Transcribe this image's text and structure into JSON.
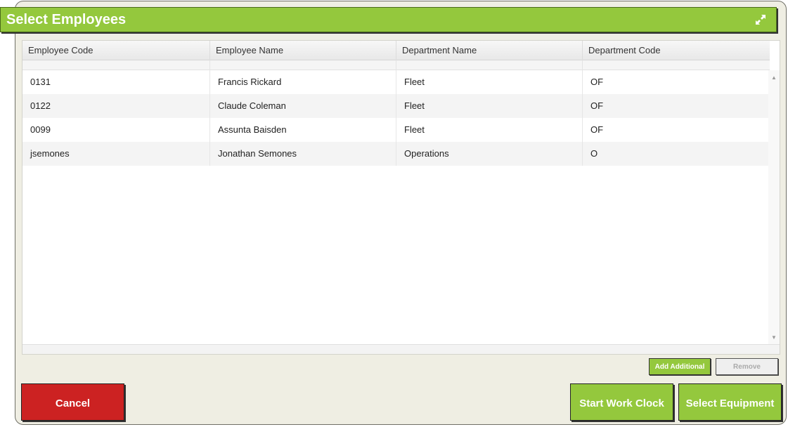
{
  "dialog": {
    "title": "Select Employees"
  },
  "table": {
    "columns": [
      "Employee Code",
      "Employee Name",
      "Department Name",
      "Department Code"
    ],
    "rows": [
      [
        "0131",
        "Francis Rickard",
        "Fleet",
        "OF"
      ],
      [
        "0122",
        "Claude Coleman",
        "Fleet",
        "OF"
      ],
      [
        "0099",
        "Assunta Baisden",
        "Fleet",
        "OF"
      ],
      [
        "jsemones",
        "Jonathan Semones",
        "Operations",
        "O"
      ]
    ]
  },
  "actions": {
    "add_additional": "Add Additional",
    "remove": "Remove",
    "cancel": "Cancel",
    "start_work_clock": "Start Work Clock",
    "select_equipment": "Select Equipment"
  },
  "icons": {
    "expand": "expand-icon",
    "scroll_up": "scroll-up-arrow-icon",
    "scroll_down": "scroll-down-arrow-icon"
  },
  "colors": {
    "accent_green": "#94c83d",
    "cancel_red": "#cc2222",
    "dialog_bg": "#efeee3"
  }
}
